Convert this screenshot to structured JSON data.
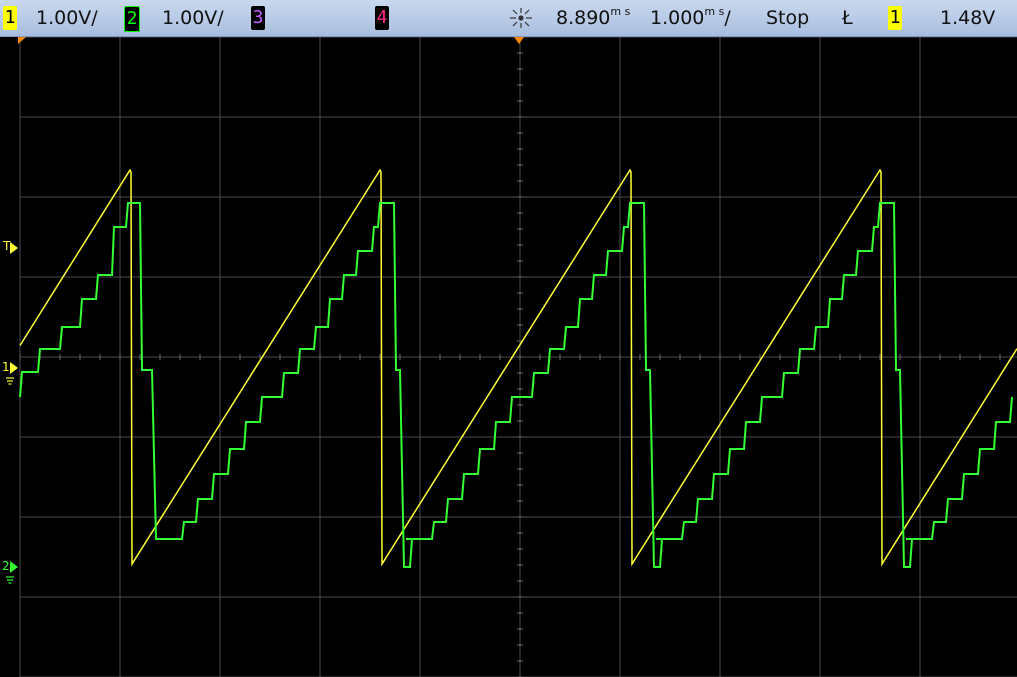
{
  "statusbar": {
    "ch1": {
      "num": "1",
      "scale": "1.00V/",
      "color": "#ffff00"
    },
    "ch2": {
      "num": "2",
      "scale": "1.00V/",
      "color": "#00ff00"
    },
    "ch3": {
      "num": "3",
      "color": "#c060ff"
    },
    "ch4": {
      "num": "4",
      "color": "#ff2d8a"
    },
    "time_delay": "8.890",
    "time_delay_unit": "m s",
    "time_scale": "1.000",
    "time_scale_unit": "m s",
    "time_scale_suffix": "/",
    "run_state": "Stop",
    "trigger_slope": "Ł",
    "trigger_source": "1",
    "trigger_level": "1.48V"
  },
  "markers": {
    "trigger_level": "T",
    "ch1_ground": "1",
    "ch2_ground": "2"
  },
  "colors": {
    "background": "#000000",
    "grid": "#4a4a4a",
    "ch1_trace": "#ffff33",
    "ch2_trace": "#33ff33",
    "trigger_marker": "#ff8a00"
  },
  "waveforms": {
    "ch1": {
      "type": "sawtooth",
      "period_ms": 2.5,
      "min_div": -2.6,
      "max_div": 2.3
    },
    "ch2": {
      "type": "staircase",
      "steps_per_period": 8,
      "period_ms": 2.5
    }
  }
}
